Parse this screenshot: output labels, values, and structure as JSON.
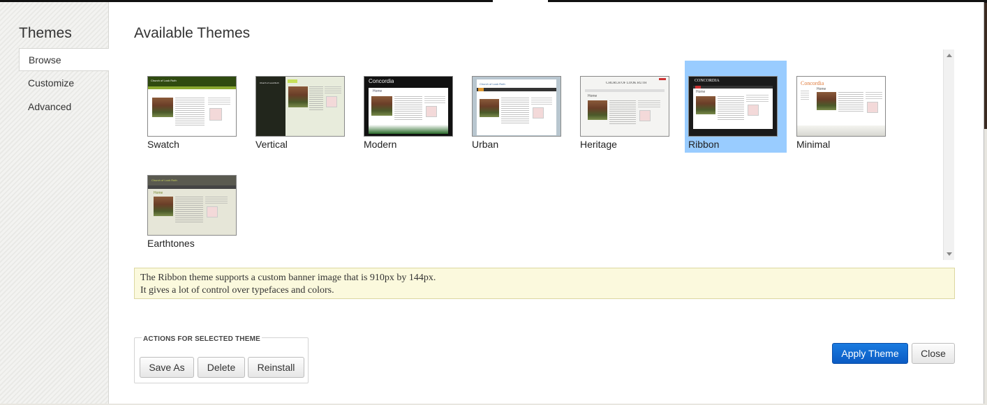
{
  "sidebar": {
    "title": "Themes",
    "items": [
      {
        "label": "Browse",
        "active": true
      },
      {
        "label": "Customize",
        "active": false
      },
      {
        "label": "Advanced",
        "active": false
      }
    ]
  },
  "main": {
    "title": "Available Themes",
    "selected_theme": "Ribbon",
    "themes": [
      {
        "name": "Swatch"
      },
      {
        "name": "Vertical"
      },
      {
        "name": "Modern"
      },
      {
        "name": "Urban"
      },
      {
        "name": "Heritage"
      },
      {
        "name": "Ribbon"
      },
      {
        "name": "Minimal"
      },
      {
        "name": "Earthtones"
      }
    ],
    "description_line1": "The Ribbon theme supports a custom banner image that is 910px by 144px.",
    "description_line2": "It gives a lot of control over typefaces and colors."
  },
  "actions": {
    "legend": "ACTIONS FOR SELECTED THEME",
    "save_as": "Save As",
    "delete": "Delete",
    "reinstall": "Reinstall"
  },
  "footer": {
    "apply": "Apply Theme",
    "close": "Close"
  },
  "thumbnails": {
    "swatch_site_name": "Church of Look Ruth",
    "vertical_site_name": "Church of Look Ruth",
    "modern_site_name": "Concordia",
    "modern_heading": "Home",
    "urban_site_name": "Church of Look Ruth",
    "heritage_site_name": "CHURCH OF LOOK RUTH",
    "heritage_heading": "Home",
    "ribbon_site_name": "CONCORDIA",
    "ribbon_heading": "Home",
    "minimal_site_name": "Concordia",
    "minimal_heading": "Home",
    "earthtones_site_name": "Church of Look Ruth",
    "earthtones_heading": "Home"
  },
  "colors": {
    "accent": "#0b5bc4",
    "selected_tile": "#99ccff",
    "description_bg": "#fbf9dd"
  }
}
